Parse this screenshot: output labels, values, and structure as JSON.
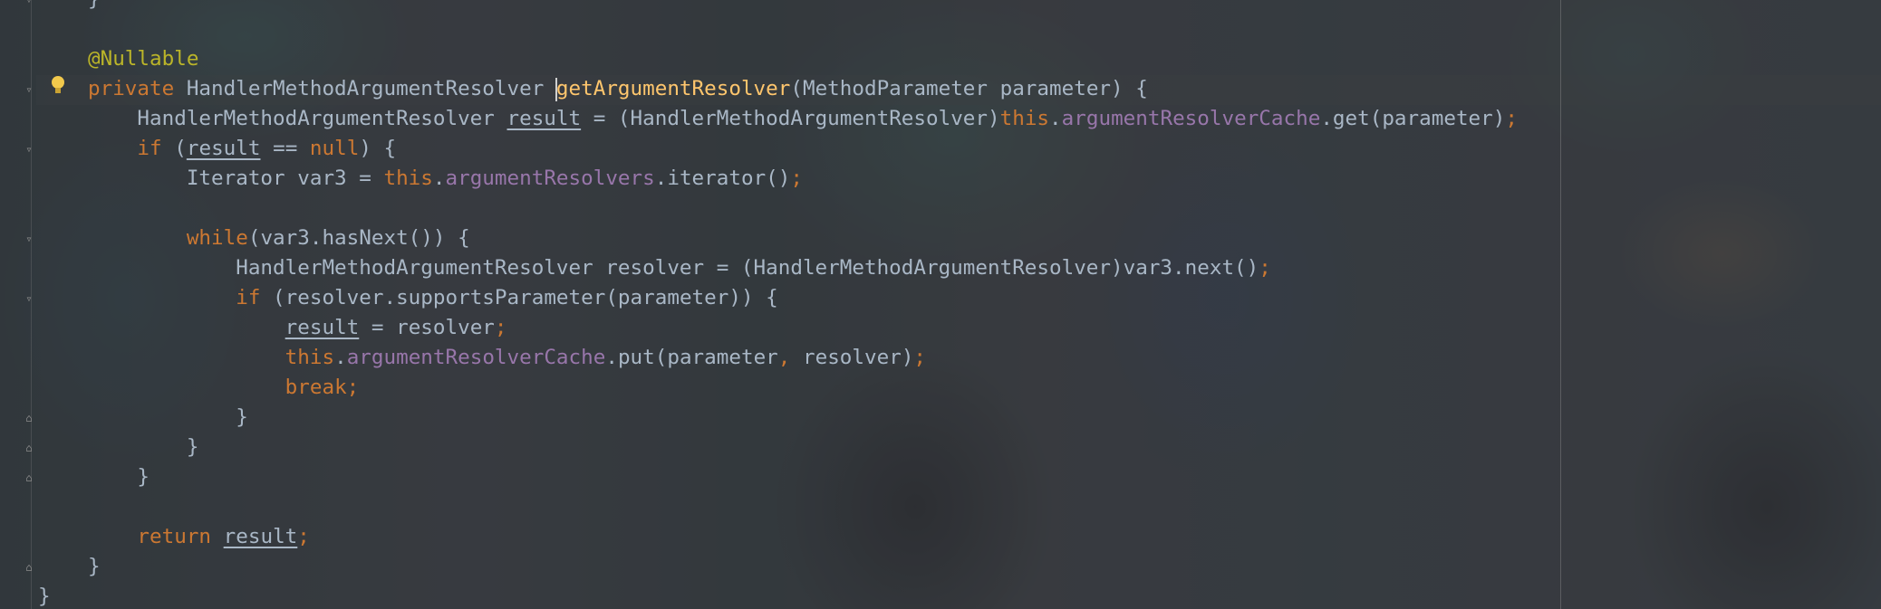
{
  "editor": {
    "lines": [
      [
        {
          "t": "}",
          "c": ""
        }
      ],
      [],
      [
        {
          "t": "@Nullable",
          "c": "ann"
        }
      ],
      [
        {
          "t": "private ",
          "c": "kw"
        },
        {
          "t": "HandlerMethodArgumentResolver ",
          "c": ""
        },
        {
          "t": "getArgumentResolver",
          "c": "fn"
        },
        {
          "t": "(MethodParameter parameter) {",
          "c": ""
        }
      ],
      [
        {
          "t": "    HandlerMethodArgumentResolver ",
          "c": ""
        },
        {
          "t": "result",
          "c": "und"
        },
        {
          "t": " = (HandlerMethodArgumentResolver)",
          "c": ""
        },
        {
          "t": "this",
          "c": "kw"
        },
        {
          "t": ".",
          "c": ""
        },
        {
          "t": "argumentResolverCache",
          "c": "fld"
        },
        {
          "t": ".get(parameter)",
          "c": ""
        },
        {
          "t": ";",
          "c": "semi"
        }
      ],
      [
        {
          "t": "    ",
          "c": ""
        },
        {
          "t": "if",
          "c": "kw"
        },
        {
          "t": " (",
          "c": ""
        },
        {
          "t": "result",
          "c": "und"
        },
        {
          "t": " == ",
          "c": ""
        },
        {
          "t": "null",
          "c": "kw"
        },
        {
          "t": ") {",
          "c": ""
        }
      ],
      [
        {
          "t": "        Iterator var3 = ",
          "c": ""
        },
        {
          "t": "this",
          "c": "kw"
        },
        {
          "t": ".",
          "c": ""
        },
        {
          "t": "argumentResolvers",
          "c": "fld"
        },
        {
          "t": ".iterator()",
          "c": ""
        },
        {
          "t": ";",
          "c": "semi"
        }
      ],
      [],
      [
        {
          "t": "        ",
          "c": ""
        },
        {
          "t": "while",
          "c": "kw"
        },
        {
          "t": "(var3.hasNext()) {",
          "c": ""
        }
      ],
      [
        {
          "t": "            HandlerMethodArgumentResolver resolver = (HandlerMethodArgumentResolver)var3.next()",
          "c": ""
        },
        {
          "t": ";",
          "c": "semi"
        }
      ],
      [
        {
          "t": "            ",
          "c": ""
        },
        {
          "t": "if",
          "c": "kw"
        },
        {
          "t": " (resolver.supportsParameter(parameter)) {",
          "c": ""
        }
      ],
      [
        {
          "t": "                ",
          "c": ""
        },
        {
          "t": "result",
          "c": "und"
        },
        {
          "t": " = resolver",
          "c": ""
        },
        {
          "t": ";",
          "c": "semi"
        }
      ],
      [
        {
          "t": "                ",
          "c": ""
        },
        {
          "t": "this",
          "c": "kw"
        },
        {
          "t": ".",
          "c": ""
        },
        {
          "t": "argumentResolverCache",
          "c": "fld"
        },
        {
          "t": ".put(parameter",
          "c": ""
        },
        {
          "t": ",",
          "c": "semi"
        },
        {
          "t": " resolver)",
          "c": ""
        },
        {
          "t": ";",
          "c": "semi"
        }
      ],
      [
        {
          "t": "                ",
          "c": ""
        },
        {
          "t": "break",
          "c": "kw"
        },
        {
          "t": ";",
          "c": "semi"
        }
      ],
      [
        {
          "t": "            }",
          "c": ""
        }
      ],
      [
        {
          "t": "        }",
          "c": ""
        }
      ],
      [
        {
          "t": "    }",
          "c": ""
        }
      ],
      [],
      [
        {
          "t": "    ",
          "c": ""
        },
        {
          "t": "return",
          "c": "kw"
        },
        {
          "t": " ",
          "c": ""
        },
        {
          "t": "result",
          "c": "und"
        },
        {
          "t": ";",
          "c": "semi"
        }
      ],
      [
        {
          "t": "}",
          "c": ""
        }
      ],
      [
        {
          "t": "}",
          "c": "outer"
        }
      ]
    ],
    "colors": {
      "keyword": "#cc7832",
      "annotation": "#bbb529",
      "method": "#ffc66d",
      "field": "#9876aa",
      "text": "#a9b7c6"
    },
    "icons": {
      "intention": "lightbulb-icon",
      "fold": "fold-marker-icon"
    }
  }
}
